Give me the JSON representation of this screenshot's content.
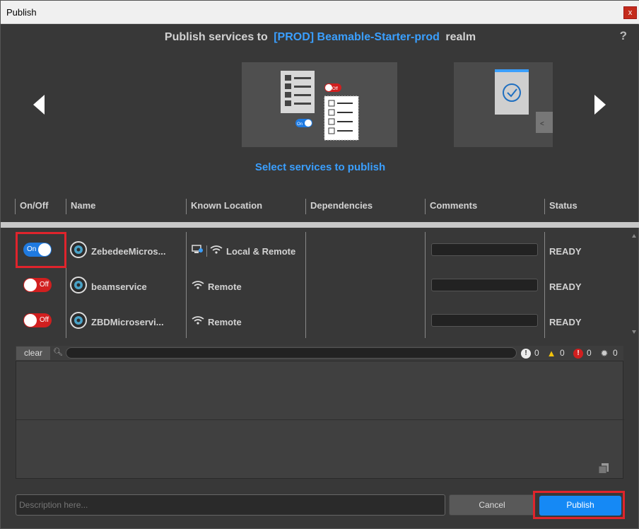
{
  "window": {
    "title": "Publish",
    "close_label": "x"
  },
  "header": {
    "prefix": "Publish services to",
    "realm": "[PROD] Beamable-Starter-prod",
    "suffix": "realm",
    "help": "?"
  },
  "carousel": {
    "caption": "Select services to publish",
    "toggle_on_label": "On",
    "toggle_off_label": "Off"
  },
  "columns": [
    "On/Off",
    "Name",
    "Known Location",
    "Dependencies",
    "Comments",
    "Status"
  ],
  "services": [
    {
      "enabled": true,
      "toggle_label": "On",
      "name": "ZebedeeMicros...",
      "location": "Local & Remote",
      "comment": "",
      "status": "READY"
    },
    {
      "enabled": false,
      "toggle_label": "Off",
      "name": "beamservice",
      "location": "Remote",
      "comment": "",
      "status": "READY"
    },
    {
      "enabled": false,
      "toggle_label": "Off",
      "name": "ZBDMicroservi...",
      "location": "Remote",
      "comment": "",
      "status": "READY"
    }
  ],
  "log": {
    "clear_label": "clear",
    "search_value": "",
    "counts": {
      "info": "0",
      "warning": "0",
      "error": "0",
      "bug": "0"
    }
  },
  "footer": {
    "description_placeholder": "Description here...",
    "cancel_label": "Cancel",
    "publish_label": "Publish"
  },
  "colors": {
    "accent": "#3a9fff",
    "toggle_on": "#1f7ae0",
    "toggle_off": "#d11f1f",
    "publish": "#1589f5",
    "highlight": "#e0242c"
  }
}
